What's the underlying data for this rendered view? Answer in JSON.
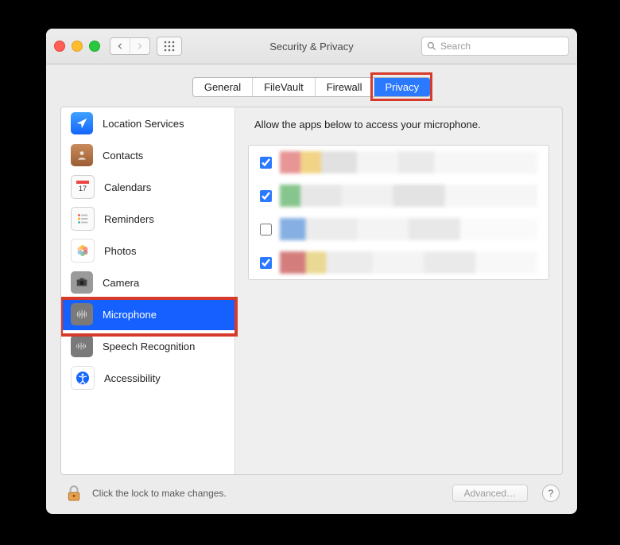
{
  "window": {
    "title": "Security & Privacy"
  },
  "search": {
    "placeholder": "Search"
  },
  "tabs": {
    "items": [
      "General",
      "FileVault",
      "Firewall",
      "Privacy"
    ],
    "selected": "Privacy"
  },
  "sidebar": {
    "items": [
      {
        "id": "location-services",
        "label": "Location Services",
        "icon": "location-arrow-icon"
      },
      {
        "id": "contacts",
        "label": "Contacts",
        "icon": "contacts-icon"
      },
      {
        "id": "calendars",
        "label": "Calendars",
        "icon": "calendar-icon"
      },
      {
        "id": "reminders",
        "label": "Reminders",
        "icon": "reminders-icon"
      },
      {
        "id": "photos",
        "label": "Photos",
        "icon": "photos-icon"
      },
      {
        "id": "camera",
        "label": "Camera",
        "icon": "camera-icon"
      },
      {
        "id": "microphone",
        "label": "Microphone",
        "icon": "microphone-icon",
        "selected": true
      },
      {
        "id": "speech-recognition",
        "label": "Speech Recognition",
        "icon": "speech-icon"
      },
      {
        "id": "accessibility",
        "label": "Accessibility",
        "icon": "accessibility-icon"
      }
    ]
  },
  "main": {
    "description": "Allow the apps below to access your microphone.",
    "apps": [
      {
        "checked": true
      },
      {
        "checked": true
      },
      {
        "checked": false
      },
      {
        "checked": true
      }
    ]
  },
  "footer": {
    "lock_text": "Click the lock to make changes.",
    "advanced_label": "Advanced…",
    "help_label": "?"
  },
  "highlights": {
    "privacy_tab": true,
    "microphone_row": true
  },
  "colors": {
    "highlight": "#d63a2a",
    "accent": "#1560ff"
  }
}
